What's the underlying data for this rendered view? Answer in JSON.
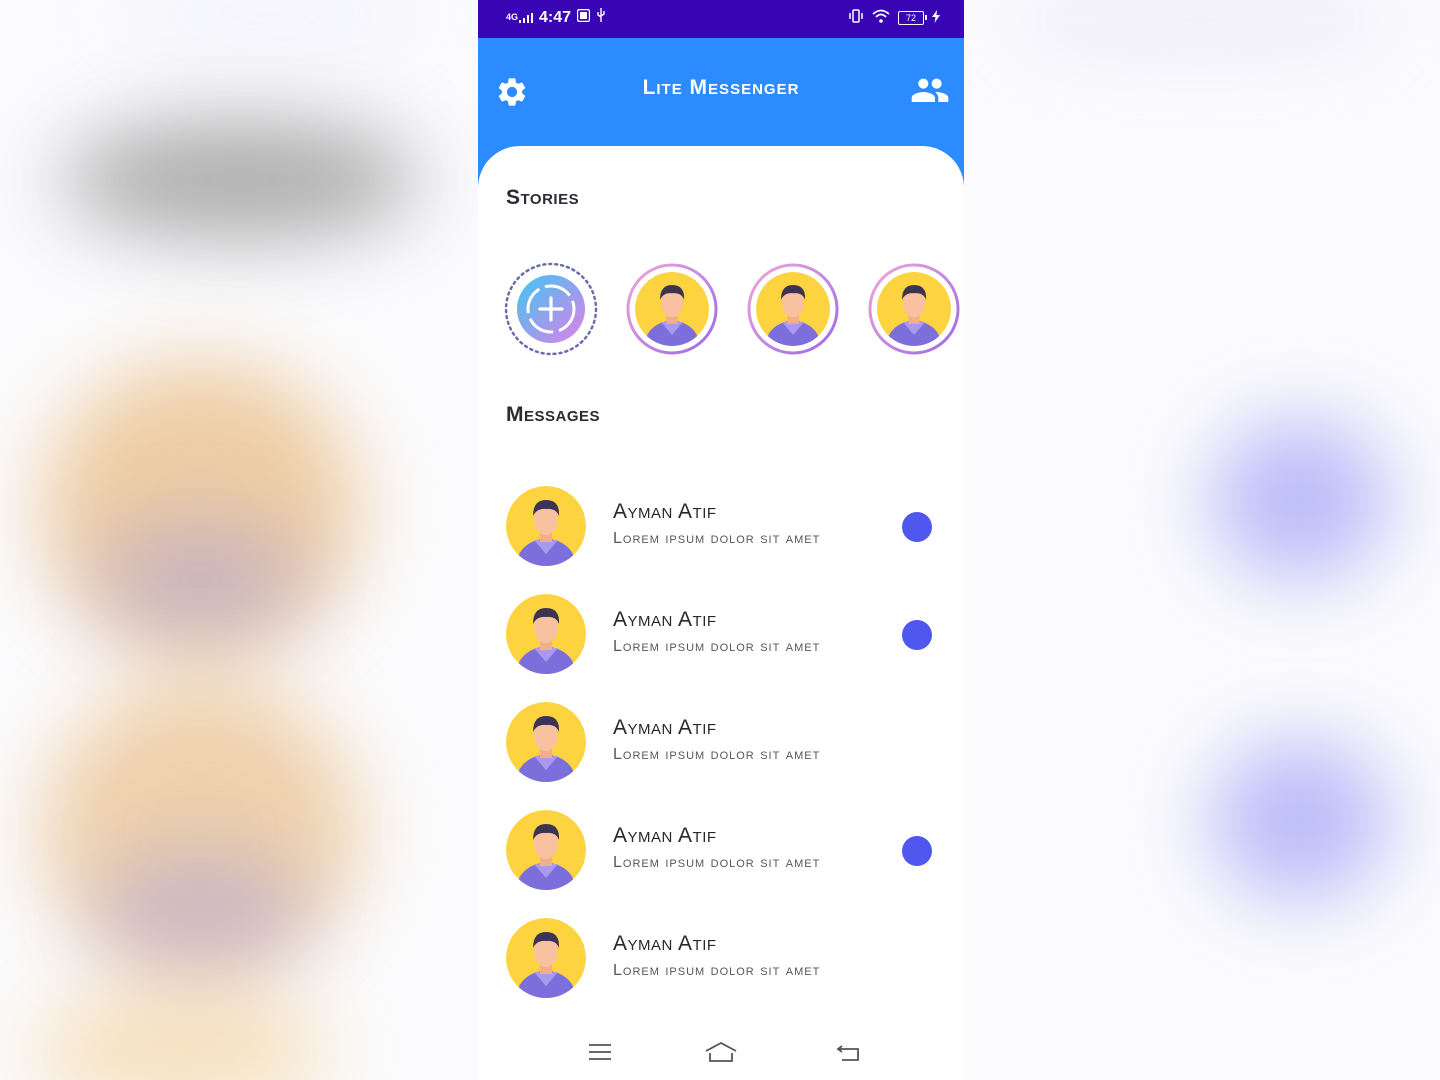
{
  "status_bar": {
    "network": "4G",
    "time": "4:47",
    "battery": "72",
    "bar_color": "#3a05b4"
  },
  "app_bar": {
    "title": "Lite Messenger",
    "left_icon": "settings-gear-icon",
    "right_icon": "people-icon",
    "background": "#2c8cff"
  },
  "stories": {
    "title": "Stories",
    "add_icon": "add-story-icon",
    "items": [
      {
        "avatar": "person-avatar"
      },
      {
        "avatar": "person-avatar"
      },
      {
        "avatar": "person-avatar"
      }
    ]
  },
  "messages": {
    "title": "Messages",
    "unread_color": "#5057ef",
    "items": [
      {
        "name": "Ayman Atif",
        "preview": "Lorem ipsum dolor sit amet",
        "unread": true
      },
      {
        "name": "Ayman Atif",
        "preview": "Lorem ipsum dolor sit amet",
        "unread": true
      },
      {
        "name": "Ayman Atif",
        "preview": "Lorem ipsum dolor sit amet",
        "unread": false
      },
      {
        "name": "Ayman Atif",
        "preview": "Lorem ipsum dolor sit amet",
        "unread": true
      },
      {
        "name": "Ayman Atif",
        "preview": "Lorem ipsum dolor sit amet",
        "unread": false
      }
    ]
  },
  "nav_bar": {
    "icons": [
      "menu-icon",
      "home-icon",
      "back-icon"
    ]
  }
}
